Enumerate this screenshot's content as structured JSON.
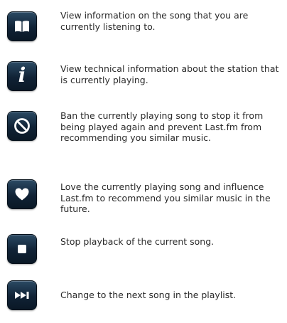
{
  "items": [
    {
      "icon": "book-icon",
      "text": "View information on the song that you are currently listening to."
    },
    {
      "icon": "info-icon",
      "glyph": "i",
      "text": "View technical information about the station that is currently playing."
    },
    {
      "icon": "ban-icon",
      "text": "Ban the currently playing song to stop it from being played again and prevent Last.fm from recommending you similar music."
    },
    {
      "icon": "heart-icon",
      "text": "Love  the currently playing song and influence Last.fm to recommend you similar music in the future."
    },
    {
      "icon": "stop-icon",
      "text": "Stop playback of the current song."
    },
    {
      "icon": "skip-next-icon",
      "text": "Change to the next song in the playlist."
    }
  ],
  "colors": {
    "button_top": "#2b4a64",
    "button_bottom": "#0a1826",
    "icon_glyph": "#ffffff",
    "text": "#2a2a2a"
  }
}
